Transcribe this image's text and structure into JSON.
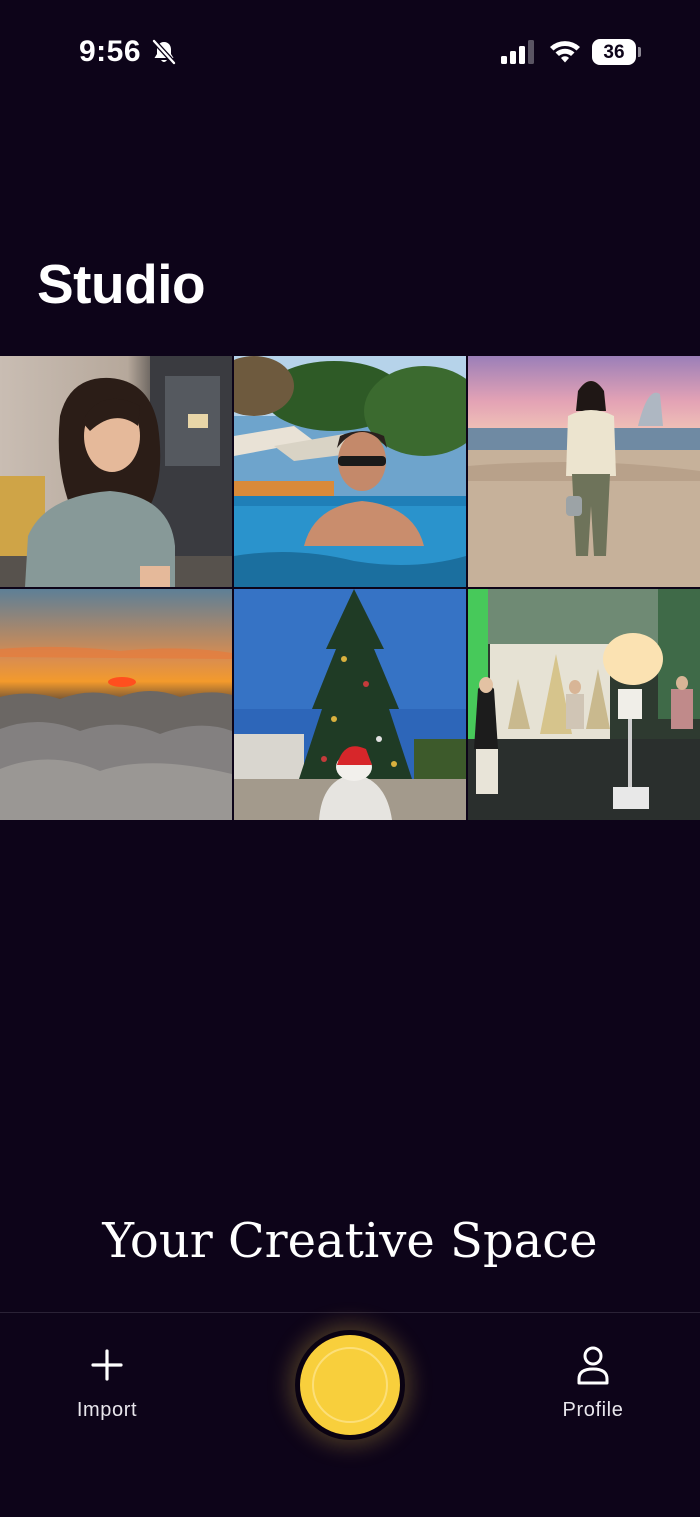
{
  "status_bar": {
    "time": "9:56",
    "battery_level": "36",
    "icons": [
      "bell-slash-icon",
      "cellular-signal-icon",
      "wifi-icon",
      "battery-icon"
    ]
  },
  "header": {
    "title": "Studio"
  },
  "gallery": {
    "photos": [
      {
        "icon": "photo-thumbnail",
        "subject": "portrait-indoor"
      },
      {
        "icon": "photo-thumbnail",
        "subject": "pool-resort"
      },
      {
        "icon": "photo-thumbnail",
        "subject": "beach-sunset"
      },
      {
        "icon": "photo-thumbnail",
        "subject": "clouds-sunset"
      },
      {
        "icon": "photo-thumbnail",
        "subject": "christmas-tree"
      },
      {
        "icon": "photo-thumbnail",
        "subject": "event-hall"
      }
    ]
  },
  "tagline": "Your Creative Space",
  "tab_bar": {
    "import_label": "Import",
    "import_icon": "plus-icon",
    "capture_icon": "capture-button",
    "profile_label": "Profile",
    "profile_icon": "person-icon"
  },
  "colors": {
    "background": "#0d0419",
    "accent": "#f8cf3c",
    "text": "#ffffff"
  }
}
